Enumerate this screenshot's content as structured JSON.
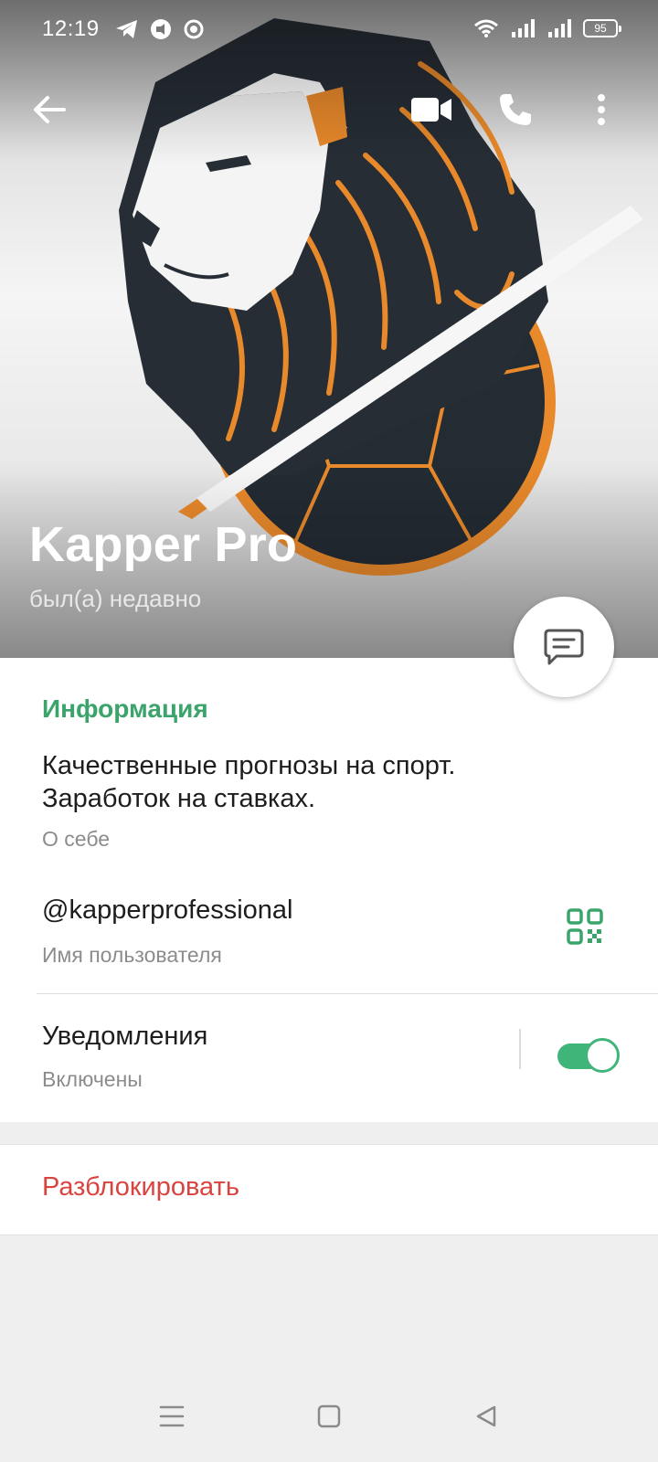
{
  "status_bar": {
    "time": "12:19",
    "battery": "95",
    "icons_left": [
      "telegram-icon",
      "media-icon",
      "record-icon"
    ],
    "icons_right": [
      "wifi-icon",
      "signal-icon",
      "signal-icon",
      "battery-icon"
    ]
  },
  "toolbar": {
    "back_icon": "arrow-left-icon",
    "video_icon": "video-camera-icon",
    "call_icon": "phone-icon",
    "more_icon": "more-vertical-icon"
  },
  "profile": {
    "name": "Kapper Pro",
    "status": "был(а) недавно",
    "avatar": "lion-football-logo"
  },
  "fab": {
    "icon": "message-icon"
  },
  "info": {
    "section_title": "Информация",
    "bio_line1": "Качественные прогнозы на спорт.",
    "bio_line2": "Заработок на ставках.",
    "bio_label": "О себе",
    "username": "@kapperprofessional",
    "username_label": "Имя пользователя",
    "qr_icon": "qr-code-icon",
    "notifications_title": "Уведомления",
    "notifications_state": "Включены",
    "notifications_on": true
  },
  "actions": {
    "unblock": "Разблокировать"
  },
  "colors": {
    "accent": "#3aa46b",
    "danger": "#d9443f",
    "toggle": "#3fb57a"
  },
  "nav_bar": {
    "items": [
      "menu-icon",
      "home-icon",
      "back-icon"
    ]
  }
}
